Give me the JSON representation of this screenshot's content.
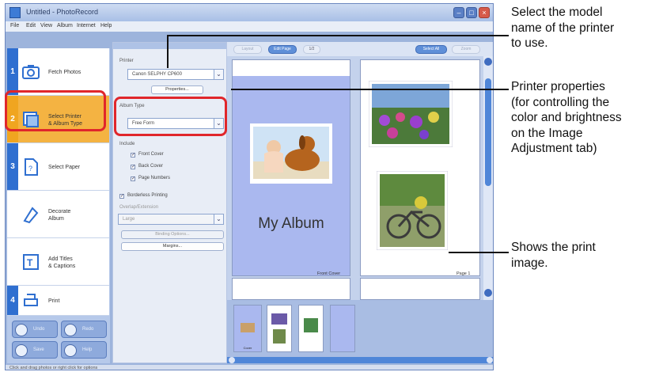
{
  "window": {
    "title": "Untitled - PhotoRecord",
    "menu": [
      "File",
      "Edit",
      "View",
      "Album",
      "Internet",
      "Help"
    ]
  },
  "nav": {
    "items": [
      {
        "num": "1",
        "label": "Fetch Photos",
        "icon": "camera-folder-icon",
        "active": false
      },
      {
        "num": "2",
        "label_line1": "Select Printer",
        "label_line2": "& Album Type",
        "icon": "printer-album-icon",
        "active": true
      },
      {
        "num": "3",
        "label": "Select Paper",
        "icon": "paper-icon",
        "active": false
      },
      {
        "label_line1": "Decorate",
        "label_line2": "Album",
        "icon": "decorate-icon",
        "active": false
      },
      {
        "label_line1": "Add Titles",
        "label_line2": "& Captions",
        "icon": "text-icon",
        "active": false
      },
      {
        "num": "4",
        "label": "Print",
        "icon": "print-icon",
        "active": false
      }
    ],
    "bottom_buttons": [
      {
        "label": "Undo",
        "icon": "undo-icon"
      },
      {
        "label": "Redo",
        "icon": "redo-icon"
      },
      {
        "label": "Save",
        "icon": "save-icon"
      },
      {
        "label": "Help",
        "icon": "help-icon"
      }
    ]
  },
  "settings": {
    "printer_label": "Printer",
    "printer_value": "Canon SELPHY CP600",
    "properties_button": "Properties...",
    "album_type_label": "Album Type",
    "album_type_value": "Free Form",
    "include_label": "Include",
    "checkboxes": [
      "Front Cover",
      "Back Cover",
      "Page Numbers"
    ],
    "borderless_label": "Borderless Printing",
    "overlap_label": "Overlap/Extension",
    "overlap_value": "Large",
    "binding_button": "Binding Options...",
    "margins_button": "Margins..."
  },
  "preview": {
    "toolbar": {
      "left_dim": "Layout",
      "edit_page": "Edit Page",
      "page_count": "1/2",
      "select_all": "Select All",
      "right_dim": "Zoom"
    },
    "album_title": "My Album",
    "front_cover_label": "Front Cover",
    "page_label": "Page 1",
    "thumb_label": "Cover"
  },
  "statusbar": {
    "text": "Click and drag photos or right click for options"
  },
  "callouts": {
    "c1": [
      "Select the model",
      "name of the printer",
      "to use."
    ],
    "c2": [
      "Printer properties",
      "(for controlling the",
      "color and brightness",
      "on the Image",
      "Adjustment tab)"
    ],
    "c3": [
      "Shows the print",
      "image."
    ]
  },
  "colors": {
    "highlight": "#e0262b",
    "accent": "#2f6fd0",
    "active_step": "#f4b342"
  }
}
